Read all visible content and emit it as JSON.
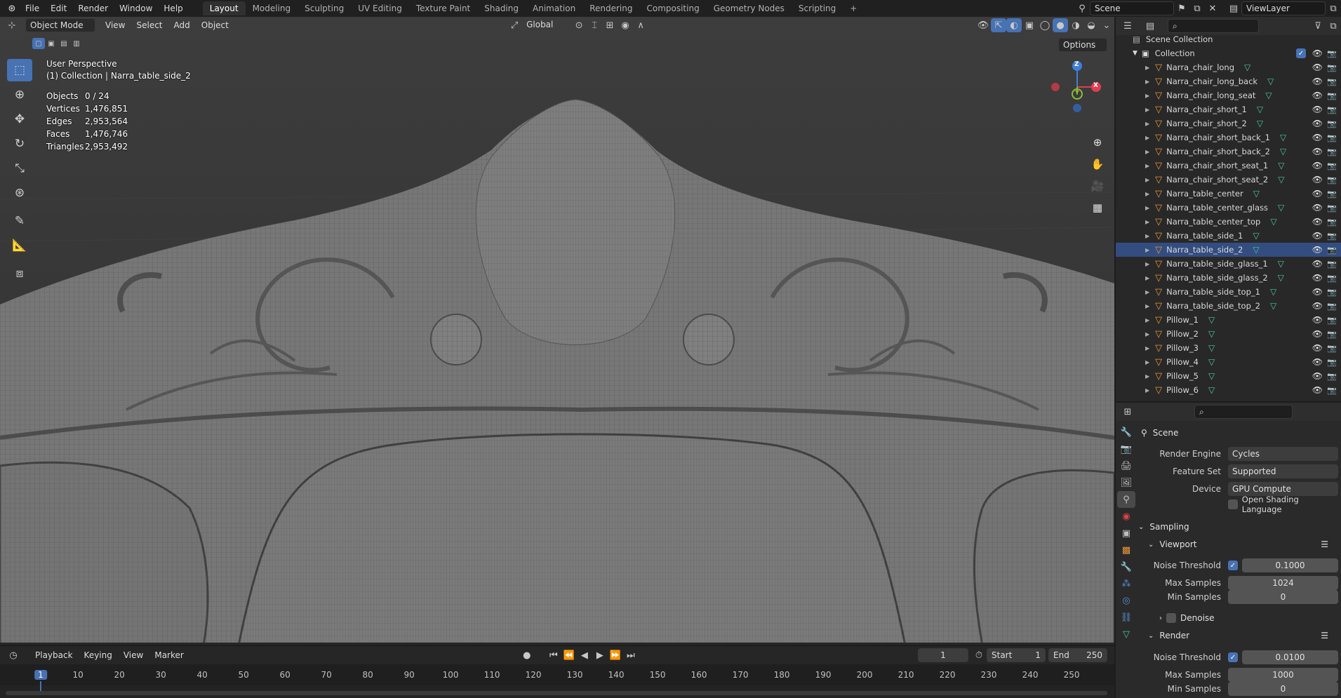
{
  "topbar": {
    "menus": [
      "File",
      "Edit",
      "Render",
      "Window",
      "Help"
    ],
    "workspaces": [
      "Layout",
      "Modeling",
      "Sculpting",
      "UV Editing",
      "Texture Paint",
      "Shading",
      "Animation",
      "Rendering",
      "Compositing",
      "Geometry Nodes",
      "Scripting"
    ],
    "active_workspace": "Layout",
    "add_workspace": "+",
    "scene": "Scene",
    "view_layer": "ViewLayer"
  },
  "viewport": {
    "mode": "Object Mode",
    "menus": [
      "View",
      "Select",
      "Add",
      "Object"
    ],
    "transform_orientation": "Global",
    "options_label": "Options",
    "perspective_label": "User Perspective",
    "collection_label": "(1) Collection | Narra_table_side_2",
    "stats": [
      {
        "label": "Objects",
        "value": "0 / 24"
      },
      {
        "label": "Vertices",
        "value": "1,476,851"
      },
      {
        "label": "Edges",
        "value": "2,953,564"
      },
      {
        "label": "Faces",
        "value": "1,476,746"
      },
      {
        "label": "Triangles",
        "value": "2,953,492"
      }
    ],
    "gizmo": {
      "z": "Z",
      "x": "X",
      "y": "Y"
    }
  },
  "timeline": {
    "menus": [
      "Playback",
      "Keying",
      "View",
      "Marker"
    ],
    "current_frame": "1",
    "start_label": "Start",
    "start": "1",
    "end_label": "End",
    "end": "250",
    "ticks": [
      "1",
      "10",
      "20",
      "30",
      "40",
      "50",
      "60",
      "70",
      "80",
      "90",
      "100",
      "110",
      "120",
      "130",
      "140",
      "150",
      "160",
      "170",
      "180",
      "190",
      "200",
      "210",
      "220",
      "230",
      "240",
      "250"
    ]
  },
  "outliner": {
    "scene_collection": "Scene Collection",
    "collection": "Collection",
    "selected": "Narra_table_side_2",
    "items": [
      "Narra_chair_long",
      "Narra_chair_long_back",
      "Narra_chair_long_seat",
      "Narra_chair_short_1",
      "Narra_chair_short_2",
      "Narra_chair_short_back_1",
      "Narra_chair_short_back_2",
      "Narra_chair_short_seat_1",
      "Narra_chair_short_seat_2",
      "Narra_table_center",
      "Narra_table_center_glass",
      "Narra_table_center_top",
      "Narra_table_side_1",
      "Narra_table_side_2",
      "Narra_table_side_glass_1",
      "Narra_table_side_glass_2",
      "Narra_table_side_top_1",
      "Narra_table_side_top_2",
      "Pillow_1",
      "Pillow_2",
      "Pillow_3",
      "Pillow_4",
      "Pillow_5",
      "Pillow_6"
    ]
  },
  "properties": {
    "context": "Scene",
    "render_engine_label": "Render Engine",
    "render_engine": "Cycles",
    "feature_set_label": "Feature Set",
    "feature_set": "Supported",
    "device_label": "Device",
    "device": "GPU Compute",
    "osl_label": "Open Shading Language",
    "sampling": "Sampling",
    "viewport": "Viewport",
    "noise_threshold_label": "Noise Threshold",
    "viewport_noise_threshold": "0.1000",
    "max_samples_label": "Max Samples",
    "viewport_max_samples": "1024",
    "min_samples_label": "Min Samples",
    "viewport_min_samples": "0",
    "denoise": "Denoise",
    "render": "Render",
    "render_noise_threshold": "0.0100",
    "render_max_samples": "1000",
    "render_min_samples": "0"
  },
  "colors": {
    "accent": "#4772b3",
    "object_orange": "#e8973a",
    "mesh_green": "#47c9a0",
    "axis_x": "#e23d4f",
    "axis_y": "#8bbd36",
    "axis_z": "#3f7fd6"
  }
}
